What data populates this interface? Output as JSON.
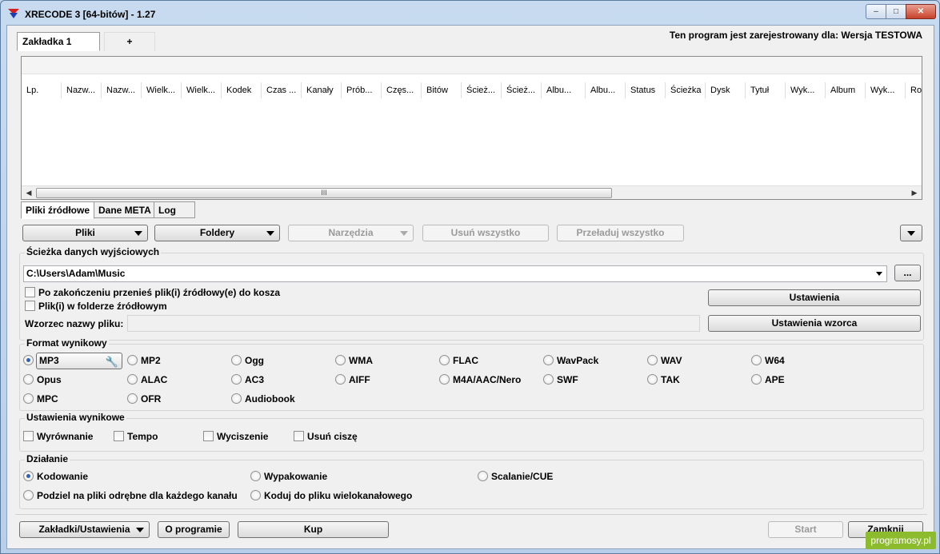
{
  "window": {
    "title": "XRECODE 3 [64-bitów] - 1.27",
    "controls": {
      "minimize": "–",
      "maximize": "□",
      "close": "✕"
    }
  },
  "top_tabs": [
    {
      "label": "Zakładka 1"
    },
    {
      "label": "+"
    }
  ],
  "registration": "Ten program jest zarejestrowany dla: Wersja TESTOWA",
  "file_list": {
    "columns": [
      "Lp.",
      "Nazw...",
      "Nazw...",
      "Wielk...",
      "Wielk...",
      "Kodek",
      "Czas ...",
      "Kanały",
      "Prób...",
      "Częs...",
      "Bitów",
      "Ścież...",
      "Ścież...",
      "Albu...",
      "Albu...",
      "Status",
      "Ścieżka",
      "Dysk",
      "Tytuł",
      "Wyk...",
      "Album",
      "Wyk...",
      "Rok"
    ],
    "scroll_thumb_label": "III"
  },
  "sub_tabs": [
    {
      "label": "Pliki źródłowe"
    },
    {
      "label": "Dane META"
    },
    {
      "label": "Log"
    }
  ],
  "toolbar": {
    "files": "Pliki",
    "folders": "Foldery",
    "tools": "Narzędzia",
    "remove_all": "Usuń wszystko",
    "reload_all": "Przeładuj wszystko"
  },
  "output_path": {
    "group_label": "Ścieżka danych wyjściowych",
    "value": "C:\\Users\\Adam\\Music",
    "browse": "...",
    "move_to_trash": "Po zakończeniu przenieś plik(i) źródłowy(e) do kosza",
    "in_source_folder": "Plik(i) w folderze źródłowym",
    "settings": "Ustawienia",
    "filename_pattern_label": "Wzorzec nazwy pliku:",
    "pattern_settings": "Ustawienia wzorca"
  },
  "output_format": {
    "group_label": "Format wynikowy",
    "selected": "MP3",
    "options": [
      "MP2",
      "Ogg",
      "WMA",
      "FLAC",
      "WavPack",
      "WAV",
      "W64",
      "Opus",
      "ALAC",
      "AC3",
      "AIFF",
      "M4A/AAC/Nero",
      "SWF",
      "TAK",
      "APE",
      "MPC",
      "OFR",
      "Audiobook"
    ]
  },
  "output_settings": {
    "group_label": "Ustawienia wynikowe",
    "options": [
      "Wyrównanie",
      "Tempo",
      "Wyciszenie",
      "Usuń ciszę"
    ]
  },
  "action": {
    "group_label": "Działanie",
    "options": [
      "Kodowanie",
      "Wypakowanie",
      "Scalanie/CUE",
      "Podziel na pliki odrębne dla każdego kanału",
      "Koduj do pliku wielokanałowego"
    ],
    "selected": "Kodowanie"
  },
  "bottom": {
    "tabs_settings": "Zakładki/Ustawienia",
    "about": "O programie",
    "buy": "Kup",
    "start": "Start",
    "close": "Zamknij"
  },
  "watermark": "programosy.pl"
}
